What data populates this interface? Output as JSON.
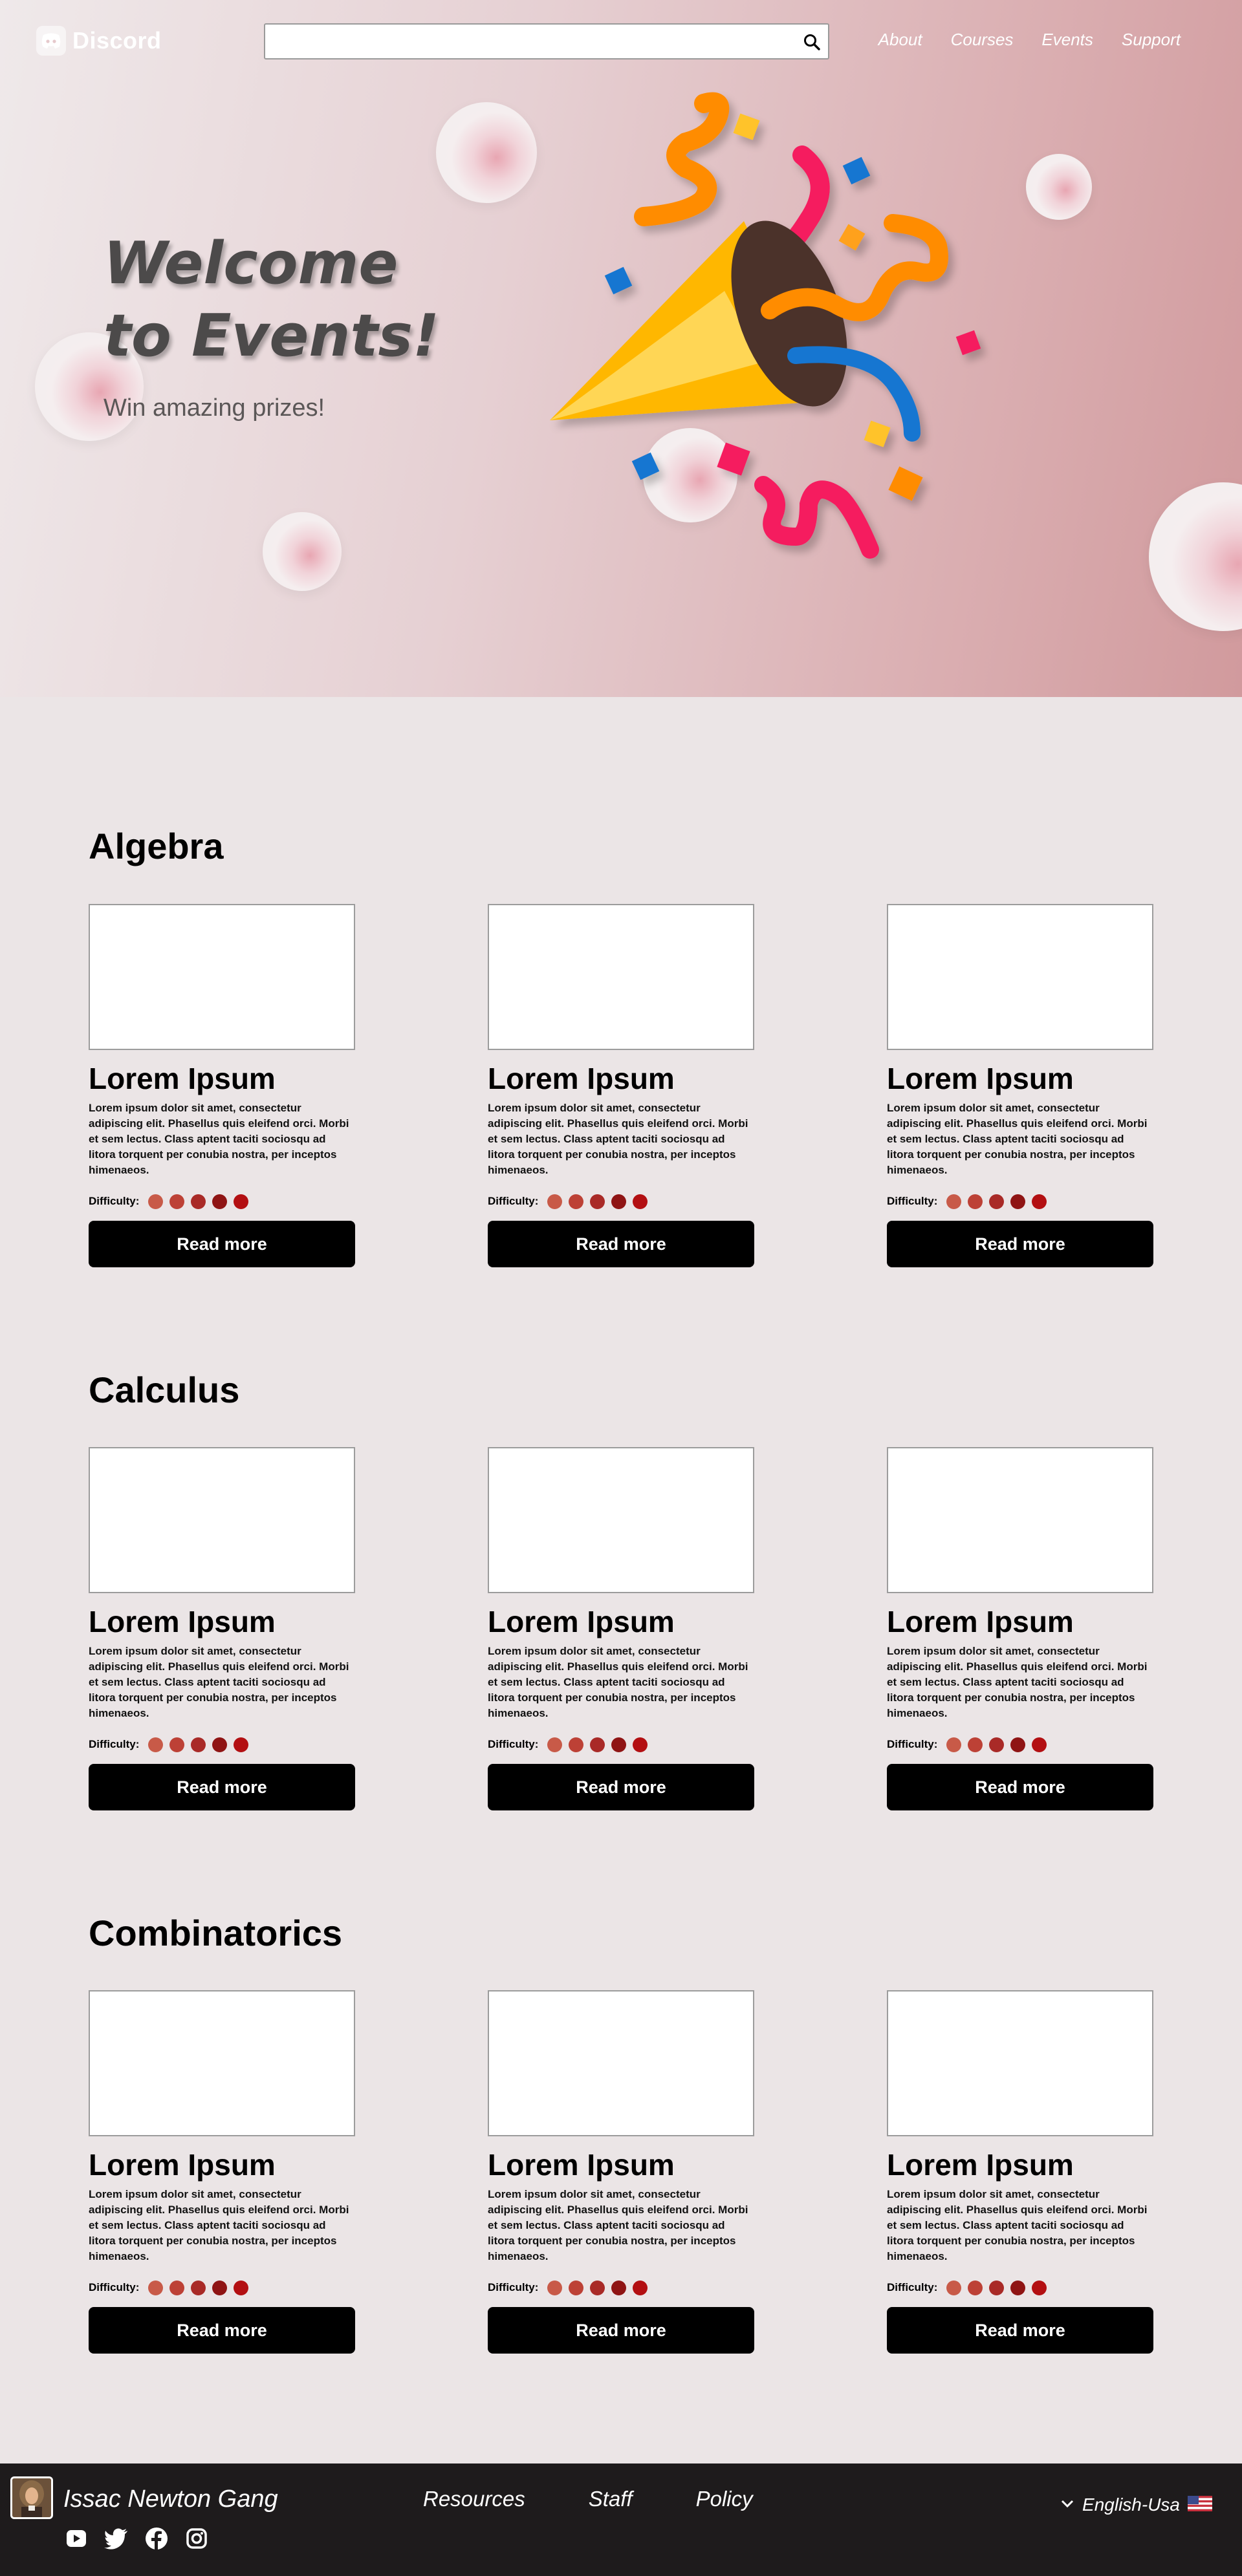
{
  "header": {
    "logo_text": "Discord",
    "search_placeholder": "",
    "nav": [
      "About",
      "Courses",
      "Events",
      "Support"
    ]
  },
  "hero": {
    "title": "Welcome to Events!",
    "subtitle": "Win amazing prizes!"
  },
  "sections": [
    {
      "title": "Algebra",
      "cards": [
        {
          "title": "Lorem Ipsum",
          "text": "Lorem ipsum dolor sit amet, consectetur adipiscing elit. Phasellus quis eleifend orci. Morbi et sem lectus. Class aptent taciti sociosqu ad litora torquent per conubia nostra, per inceptos himenaeos.",
          "difficulty_label": "Difficulty:",
          "button": "Read more"
        },
        {
          "title": "Lorem Ipsum",
          "text": "Lorem ipsum dolor sit amet, consectetur adipiscing elit. Phasellus quis eleifend orci. Morbi et sem lectus. Class aptent taciti sociosqu ad litora torquent per conubia nostra, per inceptos himenaeos.",
          "difficulty_label": "Difficulty:",
          "button": "Read more"
        },
        {
          "title": "Lorem Ipsum",
          "text": "Lorem ipsum dolor sit amet, consectetur adipiscing elit. Phasellus quis eleifend orci. Morbi et sem lectus. Class aptent taciti sociosqu ad litora torquent per conubia nostra, per inceptos himenaeos.",
          "difficulty_label": "Difficulty:",
          "button": "Read more"
        }
      ]
    },
    {
      "title": "Calculus",
      "cards": [
        {
          "title": "Lorem Ipsum",
          "text": "Lorem ipsum dolor sit amet, consectetur adipiscing elit. Phasellus quis eleifend orci. Morbi et sem lectus. Class aptent taciti sociosqu ad litora torquent per conubia nostra, per inceptos himenaeos.",
          "difficulty_label": "Difficulty:",
          "button": "Read more"
        },
        {
          "title": "Lorem Ipsum",
          "text": "Lorem ipsum dolor sit amet, consectetur adipiscing elit. Phasellus quis eleifend orci. Morbi et sem lectus. Class aptent taciti sociosqu ad litora torquent per conubia nostra, per inceptos himenaeos.",
          "difficulty_label": "Difficulty:",
          "button": "Read more"
        },
        {
          "title": "Lorem Ipsum",
          "text": "Lorem ipsum dolor sit amet, consectetur adipiscing elit. Phasellus quis eleifend orci. Morbi et sem lectus. Class aptent taciti sociosqu ad litora torquent per conubia nostra, per inceptos himenaeos.",
          "difficulty_label": "Difficulty:",
          "button": "Read more"
        }
      ]
    },
    {
      "title": "Combinatorics",
      "cards": [
        {
          "title": "Lorem Ipsum",
          "text": "Lorem ipsum dolor sit amet, consectetur adipiscing elit. Phasellus quis eleifend orci. Morbi et sem lectus. Class aptent taciti sociosqu ad litora torquent per conubia nostra, per inceptos himenaeos.",
          "difficulty_label": "Difficulty:",
          "button": "Read more"
        },
        {
          "title": "Lorem Ipsum",
          "text": "Lorem ipsum dolor sit amet, consectetur adipiscing elit. Phasellus quis eleifend orci. Morbi et sem lectus. Class aptent taciti sociosqu ad litora torquent per conubia nostra, per inceptos himenaeos.",
          "difficulty_label": "Difficulty:",
          "button": "Read more"
        },
        {
          "title": "Lorem Ipsum",
          "text": "Lorem ipsum dolor sit amet, consectetur adipiscing elit. Phasellus quis eleifend orci. Morbi et sem lectus. Class aptent taciti sociosqu ad litora torquent per conubia nostra, per inceptos himenaeos.",
          "difficulty_label": "Difficulty:",
          "button": "Read more"
        }
      ]
    }
  ],
  "difficulty_colors": [
    "#c85a48",
    "#bd4136",
    "#a92a27",
    "#8f1414",
    "#b30f12"
  ],
  "footer": {
    "brand": "Issac Newton Gang",
    "links": [
      "Resources",
      "Staff",
      "Policy"
    ],
    "language": "English-Usa",
    "socials": [
      "youtube-icon",
      "twitter-icon",
      "facebook-icon",
      "instagram-icon"
    ]
  }
}
